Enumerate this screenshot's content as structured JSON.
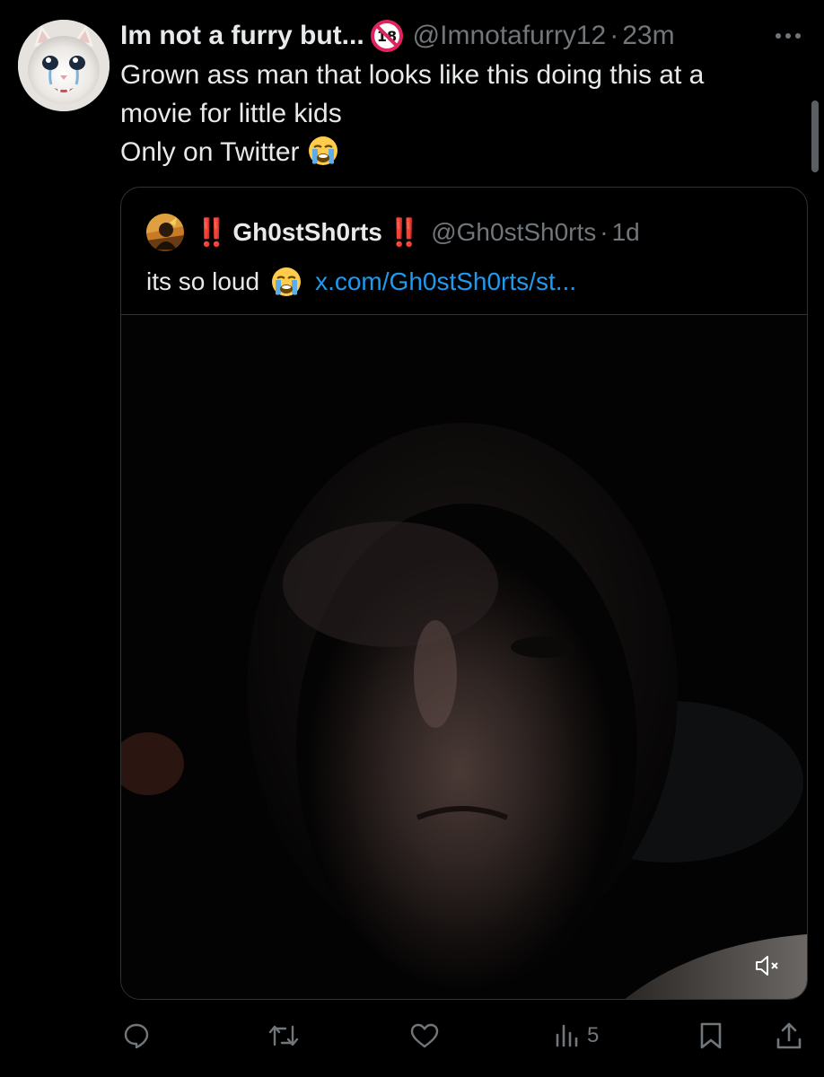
{
  "tweet": {
    "author": {
      "display_name": "Im not a furry but...",
      "handle": "@Imnotafurry12",
      "separator": "·",
      "timestamp": "23m",
      "badge_icon": "no-under-18-icon"
    },
    "text_lines": [
      "Grown ass man that looks like this doing this at a",
      "movie for little kids",
      "Only on Twitter"
    ],
    "trailing_emoji": "loudly-crying-face-icon",
    "more_icon": "more-horizontal-icon"
  },
  "quote": {
    "prefix_emoji": "‼️",
    "display_name": "Gh0stSh0rts",
    "suffix_emoji": "‼️",
    "handle": "@Gh0stSh0rts",
    "separator": "·",
    "timestamp": "1d",
    "text": "its so loud",
    "emoji": "loudly-crying-face-icon",
    "link": "x.com/Gh0stSh0rts/st...",
    "media": {
      "type": "video",
      "muted": true,
      "mute_icon": "volume-muted-icon"
    }
  },
  "actions": {
    "reply_icon": "reply-icon",
    "retweet_icon": "retweet-icon",
    "like_icon": "heart-icon",
    "views_icon": "views-chart-icon",
    "views_count": "5",
    "bookmark_icon": "bookmark-icon",
    "share_icon": "share-icon"
  },
  "colors": {
    "background": "#000000",
    "text_primary": "#e7e9ea",
    "text_secondary": "#71767b",
    "link": "#1d9bf0",
    "border": "#2f3336",
    "emphasis_red": "#e0245e"
  }
}
